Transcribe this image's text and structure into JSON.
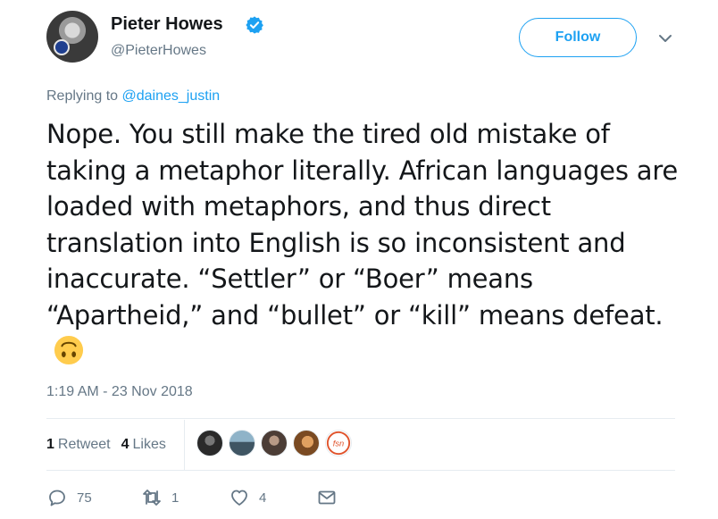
{
  "author": {
    "name": "Pieter Howes",
    "handle": "@PieterHowes",
    "verified": true
  },
  "follow_button": {
    "label": "Follow"
  },
  "replying": {
    "prefix": "Replying to ",
    "to": "@daines_justin"
  },
  "tweet": {
    "text": "Nope. You still make the tired old mistake of taking a metaphor literally. African languages are loaded with metaphors, and thus direct translation into English is so inconsistent and inaccurate. “Settler” or “Boer” means “Apartheid,” and “bullet” or “kill” means defeat.",
    "emoji": "upside-down-face-emoji"
  },
  "timestamp": "1:19 AM - 23 Nov 2018",
  "stats": {
    "retweets_count": "1",
    "retweets_label": "Retweet",
    "likes_count": "4",
    "likes_label": "Likes"
  },
  "likers": [
    {
      "icon": "liker-avatar-1",
      "color": "#3b3b3b"
    },
    {
      "icon": "liker-avatar-2",
      "color": "#5b7a8c"
    },
    {
      "icon": "liker-avatar-3",
      "color": "#6e5a50"
    },
    {
      "icon": "liker-avatar-4",
      "color": "#c07a3e"
    },
    {
      "icon": "liker-avatar-fsn",
      "color": "#e0522a"
    }
  ],
  "actions": {
    "reply_count": "75",
    "retweet_count": "1",
    "like_count": "4"
  },
  "colors": {
    "accent": "#1da1f2",
    "text": "#14171a",
    "muted": "#657786"
  }
}
